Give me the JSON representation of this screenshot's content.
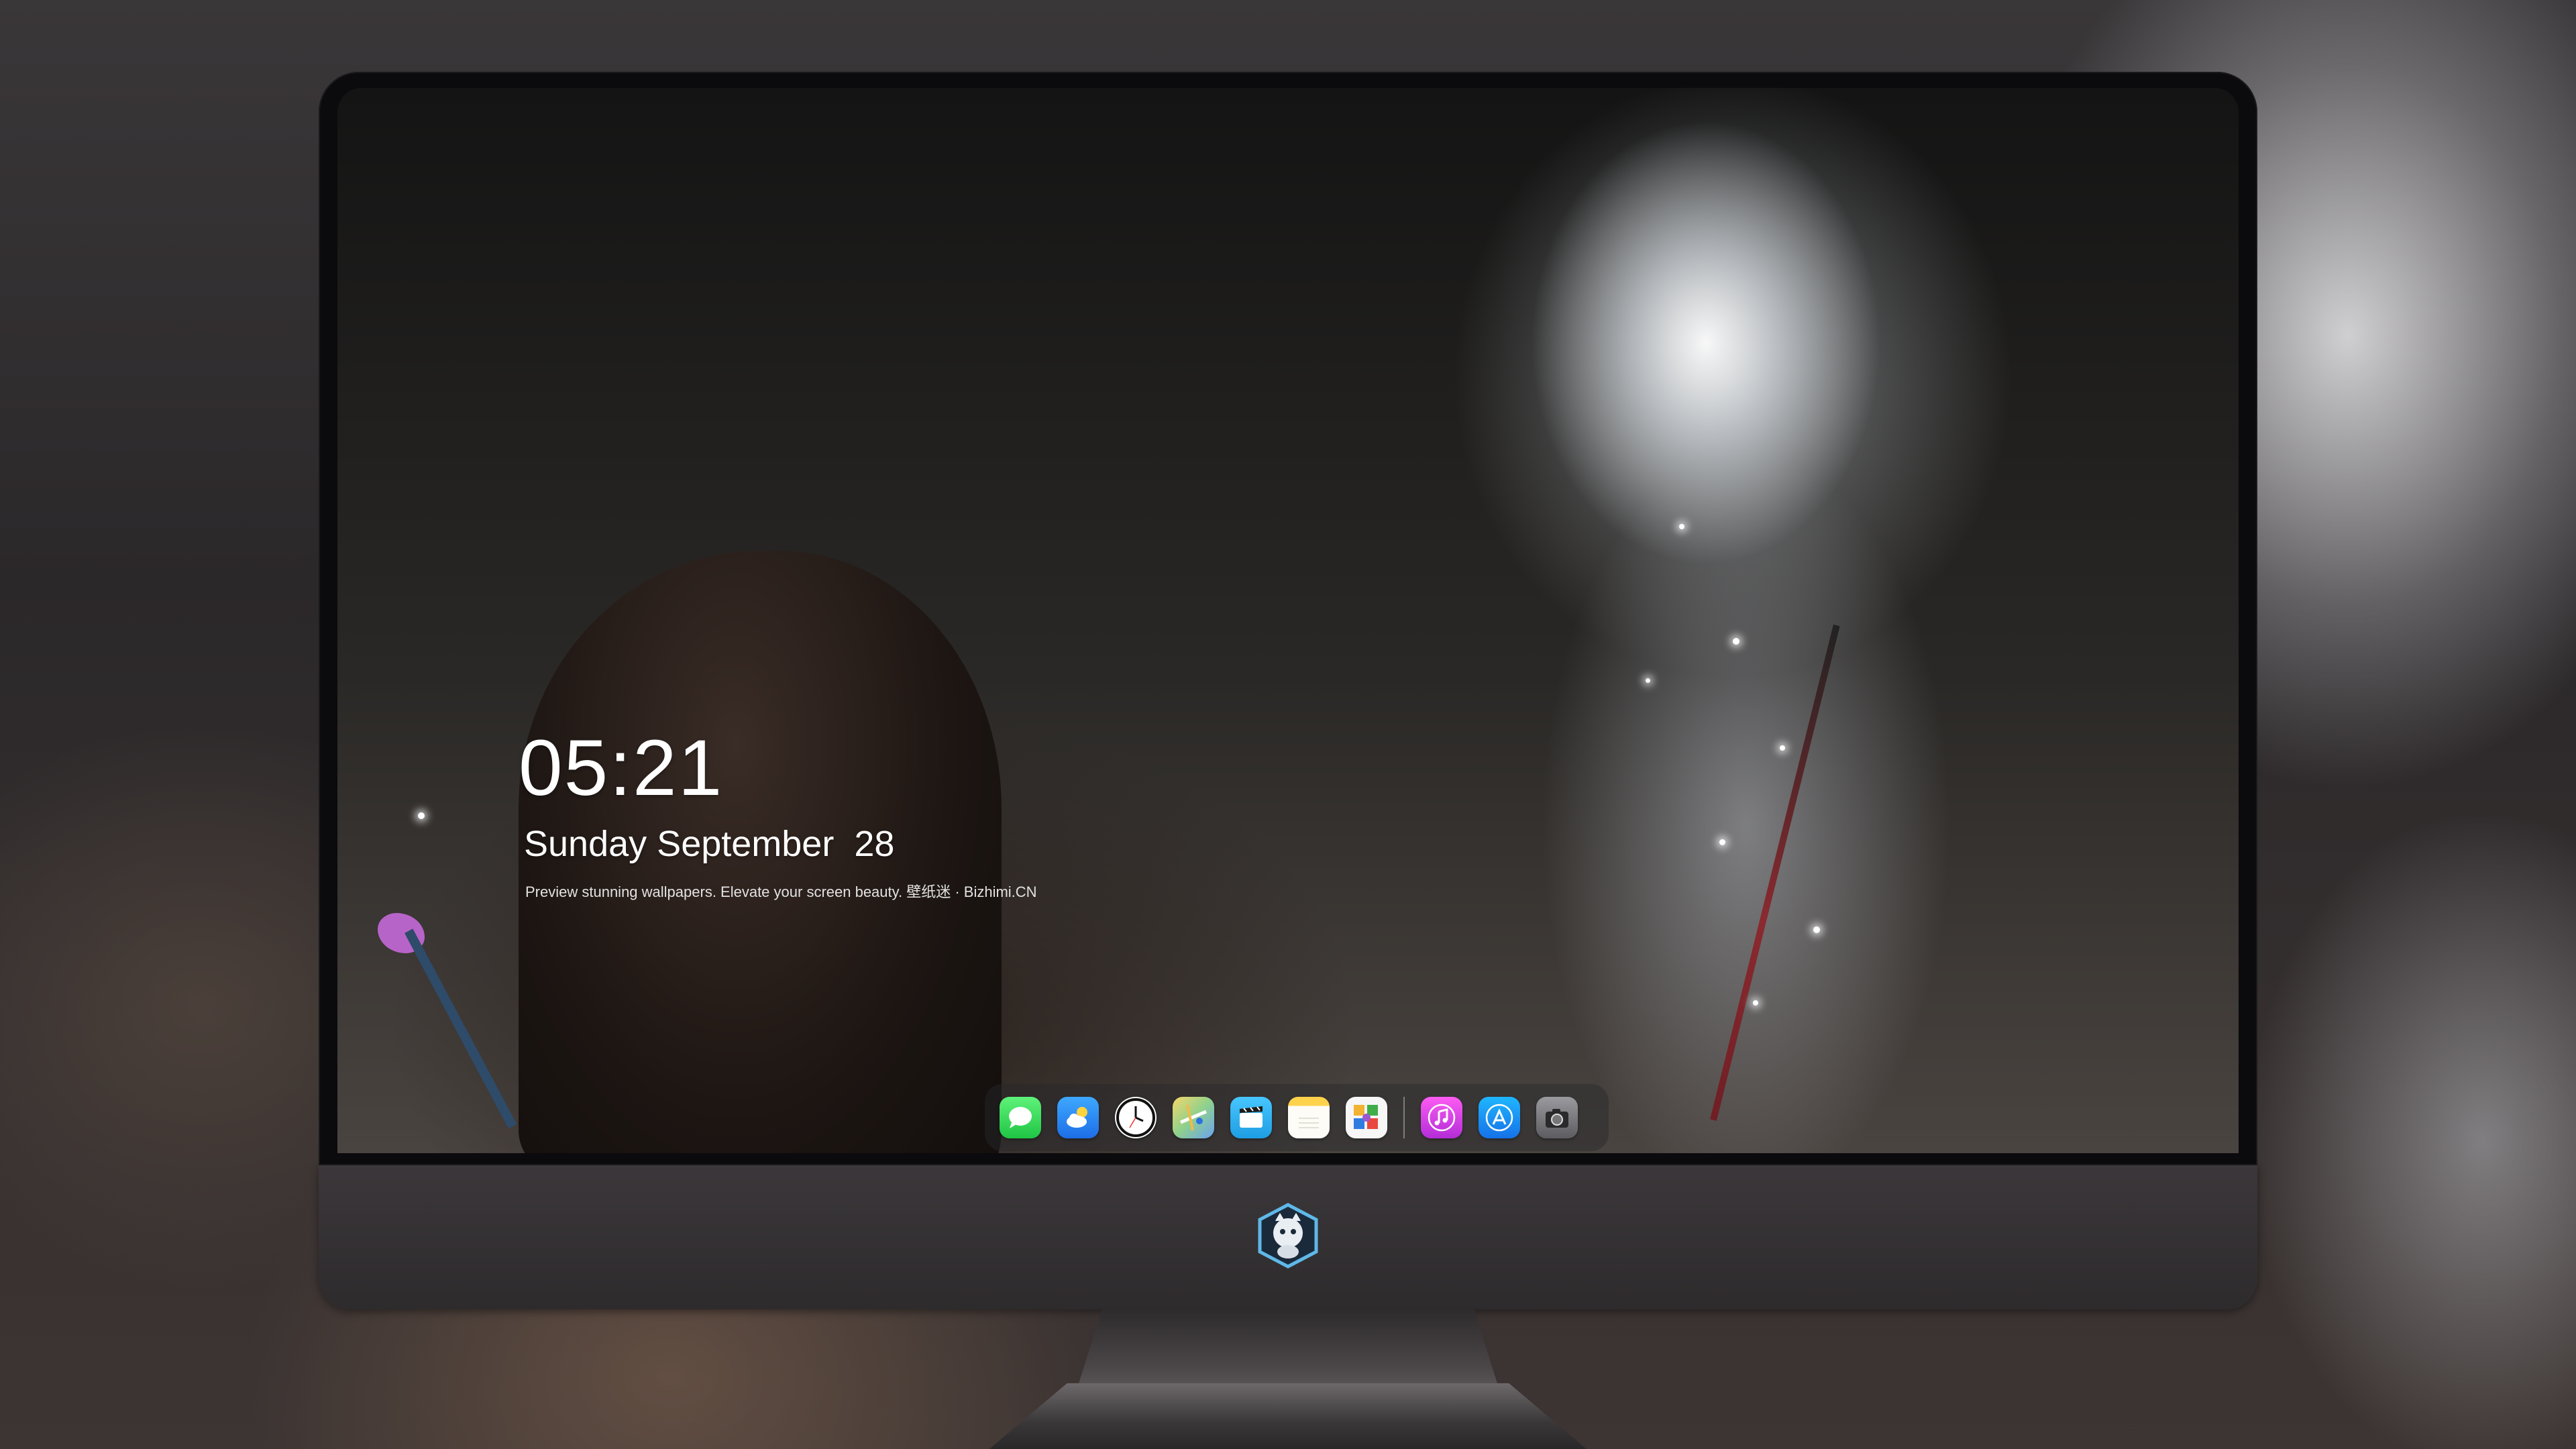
{
  "lock_screen": {
    "time": "05:21",
    "day": "Sunday",
    "month": "September",
    "date": "28",
    "tagline": "Preview stunning wallpapers. Elevate your screen beauty. 壁纸迷 · Bizhimi.CN"
  },
  "dock": {
    "apps": [
      {
        "name": "Messages",
        "icon": "messages-icon"
      },
      {
        "name": "Weather",
        "icon": "weather-icon"
      },
      {
        "name": "Clock",
        "icon": "clock-icon"
      },
      {
        "name": "Maps",
        "icon": "maps-icon"
      },
      {
        "name": "Clips",
        "icon": "clips-icon"
      },
      {
        "name": "Notes",
        "icon": "notes-icon"
      },
      {
        "name": "Photos",
        "icon": "photos-icon"
      },
      {
        "name": "Music",
        "icon": "music-icon"
      },
      {
        "name": "App Store",
        "icon": "app-store-icon"
      },
      {
        "name": "Camera",
        "icon": "camera-icon"
      }
    ]
  },
  "colors": {
    "bezel": "#0b0b0d",
    "chin": "#3b373a",
    "text": "#ffffff"
  }
}
